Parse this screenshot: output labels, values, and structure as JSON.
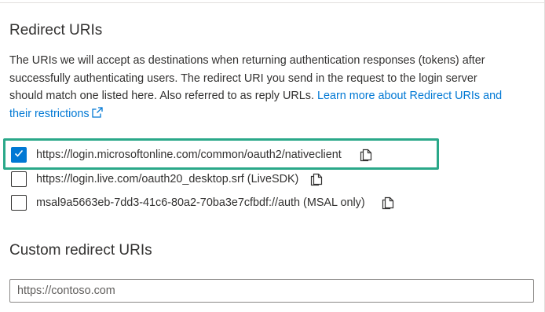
{
  "redirect_section": {
    "title": "Redirect URIs",
    "description": "The URIs we will accept as destinations when returning authentication responses (tokens) after successfully authenticating users. The redirect URI you send in the request to the login server should match one listed here. Also referred to as reply URLs.",
    "learn_more_label": "Learn more about Redirect URIs and their restrictions",
    "learn_more_icon": "external-link-icon",
    "link_color": "#0078d4",
    "uris": [
      {
        "label": "https://login.microsoftonline.com/common/oauth2/nativeclient",
        "checked": true,
        "copy_icon": "copy-icon"
      },
      {
        "label": "https://login.live.com/oauth20_desktop.srf (LiveSDK)",
        "checked": false,
        "copy_icon": "copy-icon"
      },
      {
        "label": "msal9a5663eb-7dd3-41c6-80a2-70ba3e7cfbdf://auth (MSAL only)",
        "checked": false,
        "copy_icon": "copy-icon"
      }
    ],
    "highlight_color": "#2aa889",
    "checkbox_checked_color": "#0078d4"
  },
  "custom_section": {
    "title": "Custom redirect URIs",
    "input_value": "",
    "input_placeholder": "https://contoso.com"
  }
}
